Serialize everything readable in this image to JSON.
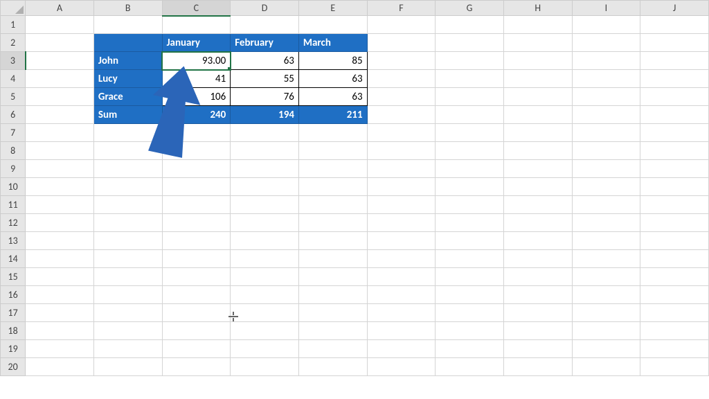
{
  "columns": [
    "A",
    "B",
    "C",
    "D",
    "E",
    "F",
    "G",
    "H",
    "I",
    "J"
  ],
  "rows": [
    "1",
    "2",
    "3",
    "4",
    "5",
    "6",
    "7",
    "8",
    "9",
    "10",
    "11",
    "12",
    "13",
    "14",
    "15",
    "16",
    "17",
    "18",
    "19",
    "20"
  ],
  "table": {
    "header": {
      "b": "",
      "c": "January",
      "d": "February",
      "e": "March"
    },
    "r1": {
      "name": "John",
      "c": "93.00",
      "d": "63",
      "e": "85"
    },
    "r2": {
      "name": "Lucy",
      "c": "41",
      "d": "55",
      "e": "63"
    },
    "r3": {
      "name": "Grace",
      "c": "106",
      "d": "76",
      "e": "63"
    },
    "sum": {
      "name": "Sum",
      "c": "240",
      "d": "194",
      "e": "211"
    }
  },
  "active_cell": "C3",
  "chart_data": {
    "type": "table",
    "columns": [
      "January",
      "February",
      "March"
    ],
    "rows": [
      "John",
      "Lucy",
      "Grace",
      "Sum"
    ],
    "values": [
      [
        93.0,
        63,
        85
      ],
      [
        41,
        55,
        63
      ],
      [
        106,
        76,
        63
      ],
      [
        240,
        194,
        211
      ]
    ]
  }
}
